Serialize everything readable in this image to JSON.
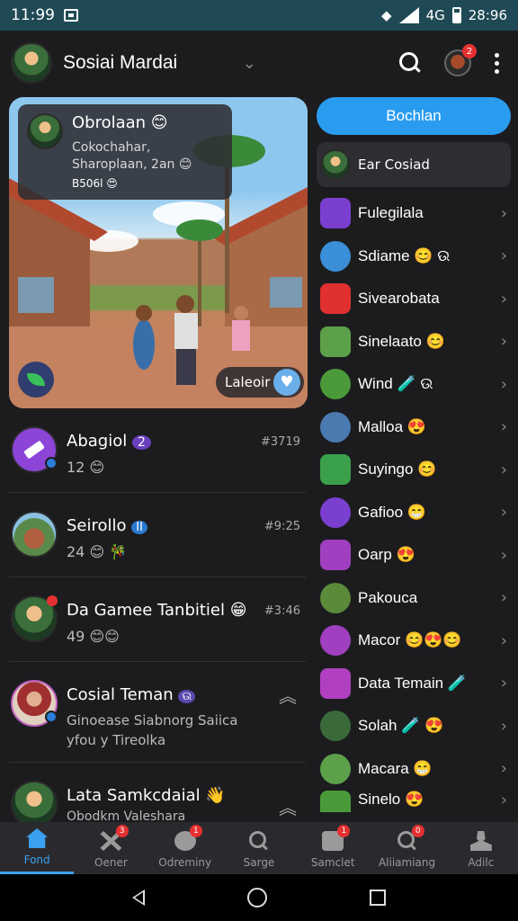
{
  "status_bar": {
    "time": "11:99",
    "right_time": "28:96",
    "network": "4G"
  },
  "header": {
    "title": "Sosiai Mardai",
    "profile_badge": "2",
    "chevron": "⌄"
  },
  "feature_card": {
    "title": "Obrolaan 😊",
    "subtitle": "Cokochahar, Sharoplaan, 2an 😊",
    "small": "B506l 😍",
    "like_label": "Laleoir",
    "like_icon": "♥"
  },
  "chats": [
    {
      "name": "Abagiol",
      "badge": "2",
      "sub": "12 😊",
      "time": "#3719"
    },
    {
      "name": "Seirollo",
      "badge": "II",
      "sub": "24 😊 🎋",
      "time": "#9:25"
    },
    {
      "name": "Da Gamee Tanbitiel 😁",
      "sub": "49 😊😊",
      "time": "#3:46"
    },
    {
      "name": "Cosial Teman",
      "badge": "ଉ",
      "sub": "Ginoease Siabnorg Saiica",
      "sub_line2": "yfou y Tireolka"
    },
    {
      "name": "Lata Samkcdaial 👋",
      "sub": "Obodkm Valeshara"
    }
  ],
  "right_panel": {
    "button": "Bochlan",
    "social_item": "Ear Cosiad",
    "items": [
      {
        "label": "Fulegilala",
        "color": "#7b3fd0"
      },
      {
        "label": "Sdiame 😊 ଉ",
        "color": "#3a8fd8"
      },
      {
        "label": "Sivearobata",
        "color": "#e03030"
      },
      {
        "label": "Sinelaato 😊",
        "color": "#5da04a"
      },
      {
        "label": "Wind 🧪 ଉ",
        "color": "#4a9a3a"
      },
      {
        "label": "Malloa 😍",
        "color": "#4a7ab0"
      },
      {
        "label": "Suyingo 😊",
        "color": "#3aa04a"
      },
      {
        "label": "Gafioo 😁",
        "color": "#7b3fd0"
      },
      {
        "label": "Oarp 😍",
        "color": "#a040c0"
      },
      {
        "label": "Pakouca",
        "color": "#5a8a3a"
      },
      {
        "label": "Macor 😊😍😊",
        "color": "#a040c0"
      },
      {
        "label": "Data Temain 🧪",
        "color": "#b040c0"
      },
      {
        "label": "Solah 🧪 😍",
        "color": "#3a6a3a"
      },
      {
        "label": "Macara 😁",
        "color": "#5da04a"
      },
      {
        "label": "Sinelo 😍",
        "color": "#4a9a3a"
      }
    ]
  },
  "bottom_nav": [
    {
      "label": "Fond",
      "badge": ""
    },
    {
      "label": "Oener",
      "badge": "3"
    },
    {
      "label": "Odreminy",
      "badge": "1"
    },
    {
      "label": "Sarge",
      "badge": ""
    },
    {
      "label": "Samclet",
      "badge": "1"
    },
    {
      "label": "Aliiamiang",
      "badge": "0"
    },
    {
      "label": "Adilc",
      "badge": ""
    }
  ]
}
